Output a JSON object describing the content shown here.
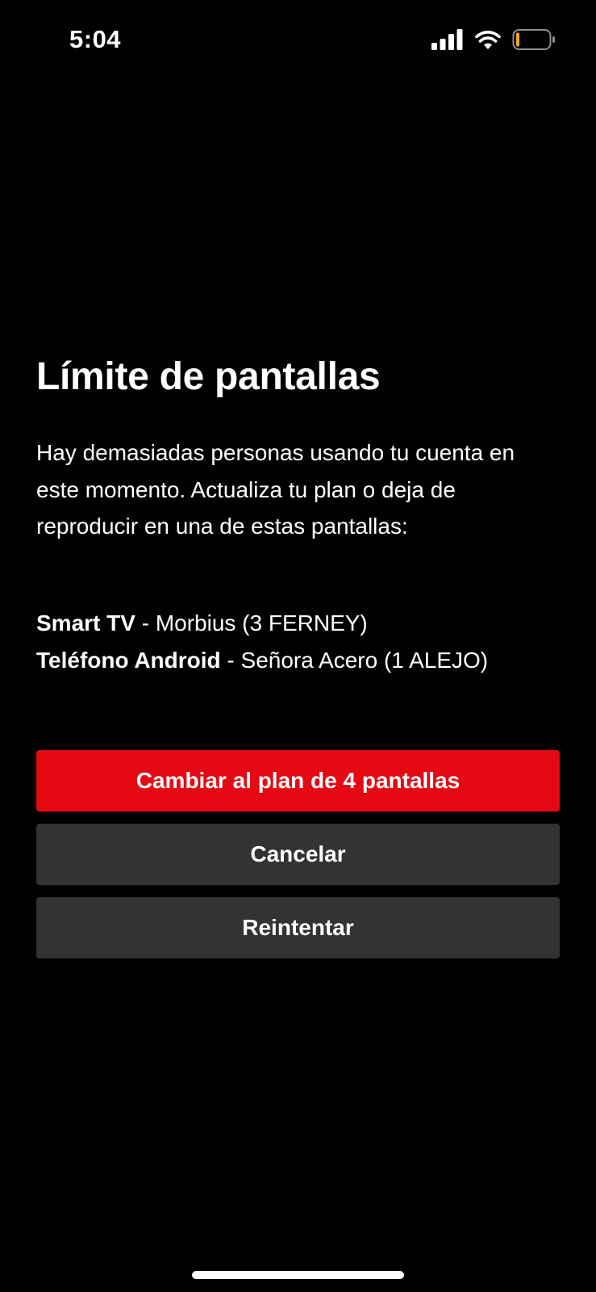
{
  "status_bar": {
    "time": "5:04",
    "icons": [
      "cellular-signal-icon",
      "wifi-icon",
      "battery-low-icon"
    ],
    "battery_accent": "#f5a623"
  },
  "dialog": {
    "title": "Límite de pantallas",
    "message": "Hay demasiadas personas usando tu cuenta en este momento. Actualiza tu plan o deja de reproducir en una de estas pantallas:",
    "devices": [
      {
        "type": "Smart TV",
        "detail": " - Morbius (3 FERNEY)"
      },
      {
        "type": "Teléfono Android",
        "detail": " - Señora Acero (1 ALEJO)"
      }
    ]
  },
  "actions": {
    "upgrade_label": "Cambiar al plan de 4 pantallas",
    "cancel_label": "Cancelar",
    "retry_label": "Reintentar"
  },
  "colors": {
    "background": "#000000",
    "primary_button": "#e50914",
    "secondary_button": "#333333",
    "text": "#ffffff"
  }
}
